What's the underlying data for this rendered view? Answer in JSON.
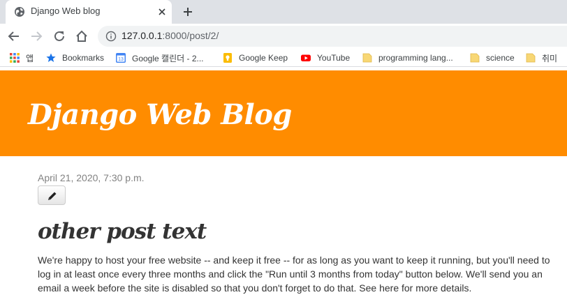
{
  "browser": {
    "tab": {
      "title": "Django Web blog",
      "icon": "globe-icon"
    },
    "address_bar": {
      "url_host": "127.0.0.1",
      "url_rest": ":8000/post/2/"
    },
    "bookmarks": [
      {
        "label": "앱",
        "icon": "apps-grid-icon"
      },
      {
        "label": "Bookmarks",
        "icon": "star-icon"
      },
      {
        "label": "Google 캘린더 - 2...",
        "icon": "calendar-icon"
      },
      {
        "label": "Google Keep",
        "icon": "keep-icon"
      },
      {
        "label": "YouTube",
        "icon": "youtube-icon"
      },
      {
        "label": "programming lang...",
        "icon": "folder-icon"
      },
      {
        "label": "science",
        "icon": "folder-icon"
      },
      {
        "label": "취미",
        "icon": "folder-icon"
      }
    ],
    "calendar_icon_text": "13"
  },
  "page": {
    "site_title": "Django Web Blog",
    "post": {
      "date": "April 21, 2020, 7:30 p.m.",
      "title": "other post text",
      "body": "We're happy to host your free website -- and keep it free -- for as long as you want to keep it running, but you'll need to log in at least once every three months and click the \"Run until 3 months from today\" button below. We'll send you an email a week before the site is disabled so that you don't forget to do that. See here for more details."
    }
  },
  "colors": {
    "header_bg": "#ff8c00",
    "tab_strip_bg": "#dee1e6",
    "omnibox_bg": "#f1f3f4"
  }
}
